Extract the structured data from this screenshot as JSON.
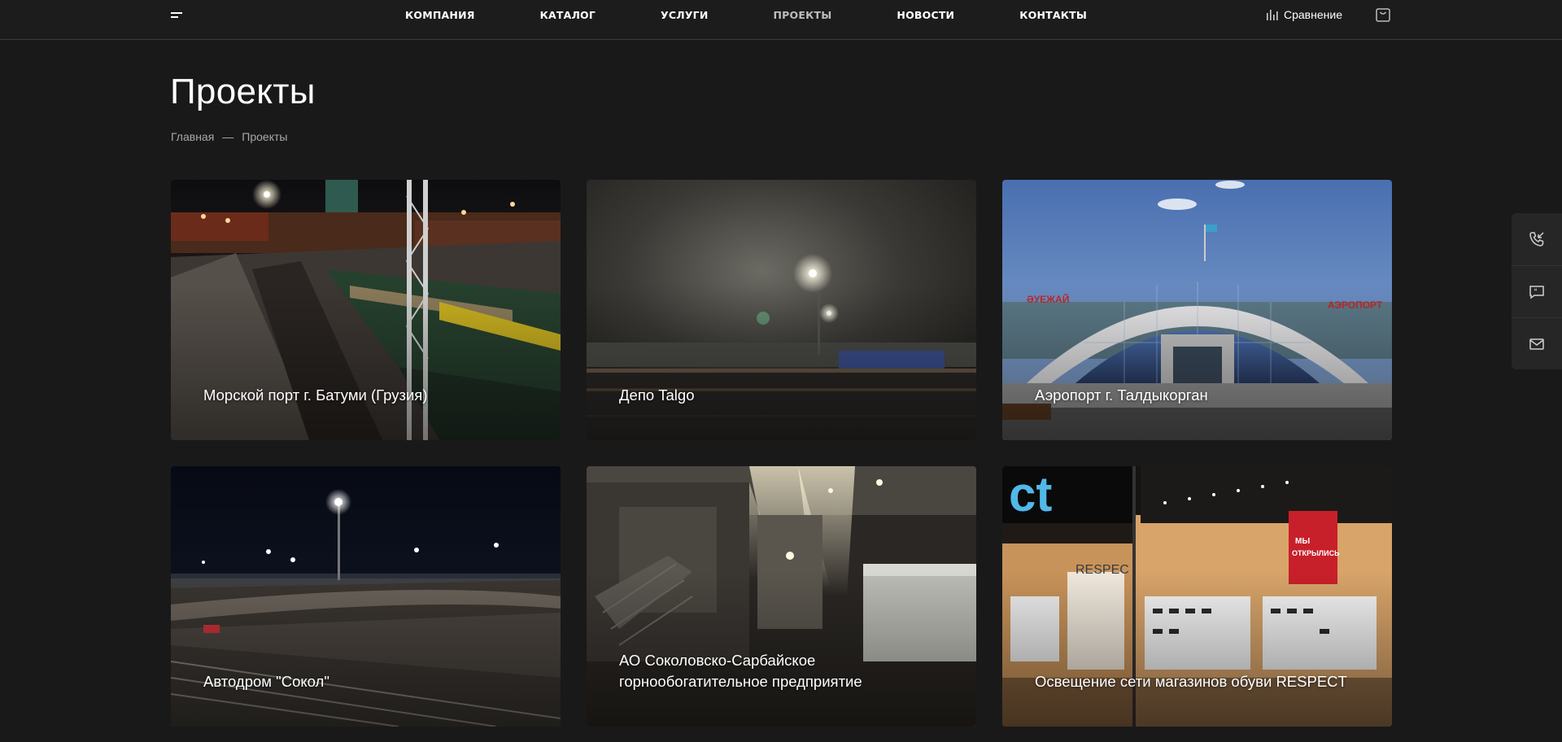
{
  "header": {
    "nav": [
      {
        "label": "КОМПАНИЯ",
        "active": false
      },
      {
        "label": "КАТАЛОГ",
        "active": false
      },
      {
        "label": "УСЛУГИ",
        "active": false
      },
      {
        "label": "ПРОЕКТЫ",
        "active": true
      },
      {
        "label": "НОВОСТИ",
        "active": false
      },
      {
        "label": "КОНТАКТЫ",
        "active": false
      }
    ],
    "compare_label": "Сравнение",
    "icons": {
      "menu": "menu-icon",
      "compare": "bar-chart-icon",
      "cart": "shopping-bag-icon"
    }
  },
  "page": {
    "title": "Проекты",
    "breadcrumb": {
      "home": "Главная",
      "separator": "—",
      "current": "Проекты"
    }
  },
  "projects": [
    {
      "title": "Морской порт г. Батуми (Грузия)",
      "scene": "port-night"
    },
    {
      "title": "Депо Talgo",
      "scene": "depot-fog"
    },
    {
      "title": "Аэропорт г. Талдыкорган",
      "scene": "airport-day"
    },
    {
      "title": "Автодром \"Сокол\"",
      "scene": "racetrack-night"
    },
    {
      "title": "АО Соколовско-Сарбайское горнообогатительное предприятие",
      "scene": "industrial-hall"
    },
    {
      "title": "Освещение сети магазинов обуви RESPECT",
      "scene": "shoe-store"
    }
  ],
  "side_panel": {
    "icons": [
      "phone-callback-icon",
      "chat-icon",
      "mail-icon"
    ]
  },
  "colors": {
    "background": "#191919",
    "header": "#1c1c1c",
    "text": "#ffffff",
    "muted": "#a9a9a9",
    "active_nav": "#bdbdbd"
  }
}
